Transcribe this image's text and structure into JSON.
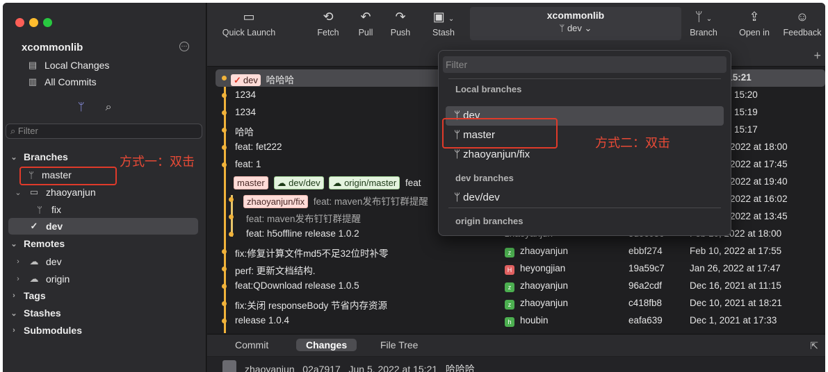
{
  "sidebar": {
    "repo_name": "xcommonlib",
    "local_changes": "Local Changes",
    "all_commits": "All Commits",
    "filter_placeholder": "Filter",
    "branches_header": "Branches",
    "branch_master": "master",
    "folder_zhaoyanjun": "zhaoyanjun",
    "branch_fix": "fix",
    "branch_dev": "dev",
    "remotes_header": "Remotes",
    "remote_dev": "dev",
    "remote_origin": "origin",
    "tags_header": "Tags",
    "stashes_header": "Stashes",
    "submodules_header": "Submodules",
    "annotation_left": "方式一：双击"
  },
  "toolbar": {
    "quick_launch": "Quick Launch",
    "fetch": "Fetch",
    "pull": "Pull",
    "push": "Push",
    "stash": "Stash",
    "title": "xcommonlib",
    "current_branch": "dev",
    "branch": "Branch",
    "open_in": "Open in",
    "feedback": "Feedback"
  },
  "commits": [
    {
      "message": "哈哈哈",
      "tags": [
        "dev"
      ],
      "time_partial": ": 15:21"
    },
    {
      "message": "1234",
      "time_partial": "15:20"
    },
    {
      "message": "1234",
      "time_partial": "15:19"
    },
    {
      "message": "哈哈",
      "time_partial": "15:17"
    },
    {
      "message": "feat: fet222",
      "time_partial": "2022 at 18:00"
    },
    {
      "message": "feat: 1",
      "time_partial": "2022 at 17:45"
    },
    {
      "message": "feat",
      "tags": [
        "master",
        "dev/dev",
        "origin/master"
      ],
      "time_partial": "2022 at 19:40"
    },
    {
      "message": "feat: maven发布钉钉群提醒",
      "tags": [
        "zhaoyanjun/fix"
      ],
      "time_partial": "2022 at 16:02"
    },
    {
      "message": "feat: maven发布钉钉群提醒",
      "time_partial": "2022 at 13:45"
    },
    {
      "message": "feat: h5offline release 1.0.2",
      "author": "zhaoyanjun",
      "hash": "5d9c05c",
      "date": "Feb 10, 2022 at 18:00"
    },
    {
      "message": "fix:修复计算文件md5不足32位时补零",
      "author": "zhaoyanjun",
      "avatar": "z",
      "hash": "ebbf274",
      "date": "Feb 10, 2022 at 17:55"
    },
    {
      "message": "perf: 更新文档结构.",
      "author": "heyongjian",
      "avatar": "H",
      "hash": "19a59c7",
      "date": "Jan 26, 2022 at 17:47"
    },
    {
      "message": "feat:QDownload release 1.0.5",
      "author": "zhaoyanjun",
      "avatar": "z",
      "hash": "96a2cdf",
      "date": "Dec 16, 2021 at 11:15"
    },
    {
      "message": "fix:关闭 responseBody 节省内存资源",
      "author": "zhaoyanjun",
      "avatar": "z",
      "hash": "c418fb8",
      "date": "Dec 10, 2021 at 18:21"
    },
    {
      "message": "release 1.0.4",
      "author": "houbin",
      "avatar": "h",
      "hash": "eafa639",
      "date": "Dec 1, 2021 at 17:33"
    }
  ],
  "dropdown": {
    "filter_placeholder": "Filter",
    "local_header": "Local branches",
    "local_dev": "dev",
    "local_master": "master",
    "local_fix": "zhaoyanjun/fix",
    "dev_header": "dev branches",
    "dev_dev": "dev/dev",
    "origin_header": "origin branches",
    "annotation_right": "方式二：双击"
  },
  "bottom": {
    "tab_commit": "Commit",
    "tab_changes": "Changes",
    "tab_file_tree": "File Tree",
    "info_author": "zhaoyanjun",
    "info_hash": "02a7917",
    "info_date": "Jun 5, 2022 at 15:21",
    "info_message": "哈哈哈"
  },
  "colors": {
    "accent_red": "#e03a2a",
    "graph_yellow": "#f0b23a",
    "avatar_green": "#4caf50",
    "avatar_red": "#e06060"
  }
}
